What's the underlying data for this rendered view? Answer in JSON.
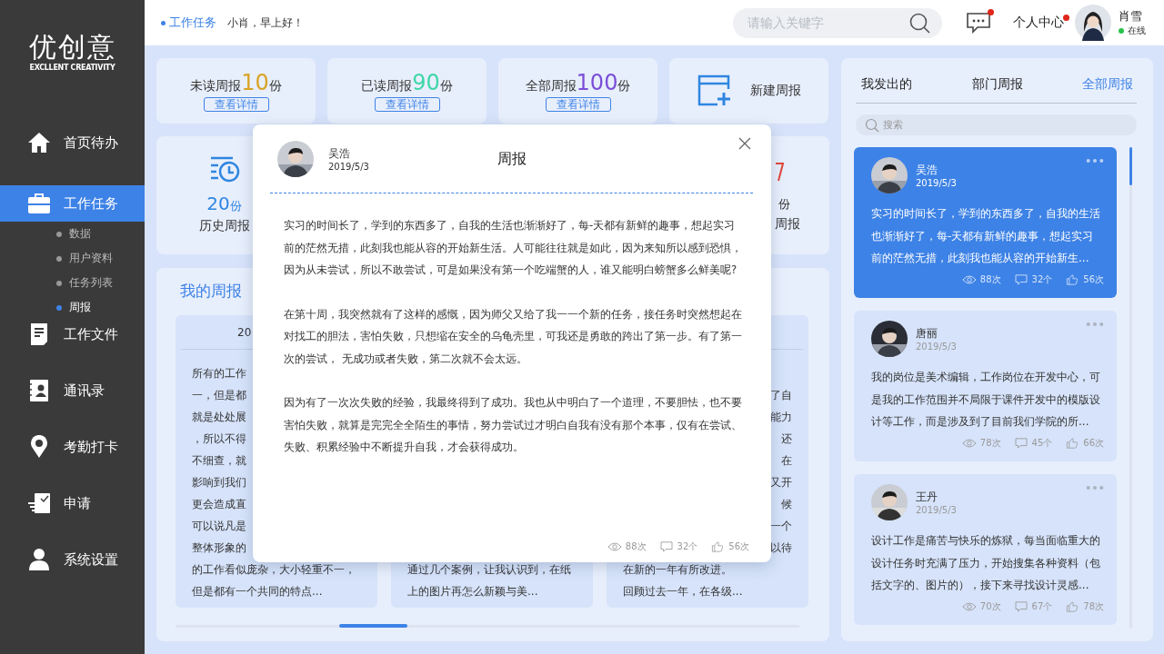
{
  "sidebar": {
    "logo": {
      "title": "优创意",
      "subtitle": "EXCLLENT CREATIVITY"
    },
    "items": [
      {
        "kind": "home",
        "label": "首页待办",
        "selected": false
      },
      {
        "kind": "briefcase",
        "label": "工作任务",
        "selected": true,
        "children": [
          {
            "label": "数据",
            "selected": false
          },
          {
            "label": "用户资料",
            "selected": false
          },
          {
            "label": "任务列表",
            "selected": false
          },
          {
            "label": "周报",
            "selected": true
          }
        ]
      },
      {
        "kind": "document",
        "label": "工作文件",
        "selected": false
      },
      {
        "kind": "contacts",
        "label": "通讯录",
        "selected": false
      },
      {
        "kind": "pin",
        "label": "考勤打卡",
        "selected": false
      },
      {
        "kind": "apply",
        "label": "申请",
        "selected": false
      },
      {
        "kind": "user",
        "label": "系统设置",
        "selected": false
      }
    ]
  },
  "topbar": {
    "breadcrumb": "工作任务",
    "greeting": "小肖，早上好！",
    "search": {
      "placeholder": "请输入关键字"
    },
    "messages": {
      "unread": true
    },
    "profile_link": {
      "label": "个人中心",
      "unread": true
    },
    "user": {
      "name": "肖雪",
      "status": "在线",
      "online": true
    }
  },
  "stats": [
    {
      "kind": "count",
      "label": "未读周报",
      "count": "10",
      "unit": "份",
      "color": "#d9a326",
      "button": "查看详情"
    },
    {
      "kind": "count",
      "label": "已读周报",
      "count": "90",
      "unit": "份",
      "color": "#3fd6a8",
      "button": "查看详情"
    },
    {
      "kind": "count",
      "label": "全部周报",
      "count": "100",
      "unit": "份",
      "color": "#7b4fd8",
      "button": "查看详情"
    },
    {
      "kind": "new",
      "label": "新建周报"
    }
  ],
  "stats_row2": [
    {
      "kind": "history",
      "count": "20",
      "unit": "份",
      "label": "历史周报"
    },
    {
      "kind": "partial",
      "unit": "份",
      "label": "周报"
    }
  ],
  "my_reports": {
    "title": "我的周报",
    "cards": [
      {
        "kind": "clipped_right",
        "date": "20",
        "lines": [
          "所有的工作",
          "一，但是都",
          "就是处处展",
          "，所以不得",
          "不细查，就",
          "影响到我们",
          "更会造成直",
          "可以说凡是",
          "整体形象的",
          "的工作看似庞杂，大小轻重不一，",
          "但是都有一个共同的特点..."
        ]
      },
      {
        "kind": "clipped_top",
        "lines": [
          "通过几个案例，让我认识到，在纸",
          "上的图片再怎么新颖与美..."
        ]
      },
      {
        "kind": "clipped_left",
        "lines": [
          "了自",
          "能力",
          "还",
          "在",
          "又开",
          "候",
          "一个",
          "以待",
          "在新的一年有所改进。",
          "回顾过去一年，在各级..."
        ]
      }
    ]
  },
  "feed": {
    "tabs": [
      {
        "label": "我发出的",
        "selected": false
      },
      {
        "label": "部门周报",
        "selected": false
      },
      {
        "label": "全部周报",
        "selected": true
      }
    ],
    "search": {
      "placeholder": "搜索"
    },
    "posts": [
      {
        "author": "吴浩",
        "date": "2019/5/3",
        "text": "实习的时间长了，学到的东西多了，自我的生活也渐渐好了，每-天都有新鲜的趣事，想起实习前的茫然无措，此刻我也能从容的开始新生...",
        "views": "88次",
        "comments": "32个",
        "likes": "56次",
        "selected": true
      },
      {
        "author": "唐丽",
        "date": "2019/5/3",
        "text": "我的岗位是美术编辑，工作岗位在开发中心，可是我的工作范围并不局限于课件开发中的模版设计等工作，而是涉及到了目前我们学院的所...",
        "views": "78次",
        "comments": "45个",
        "likes": "66次",
        "selected": false
      },
      {
        "author": "王丹",
        "date": "2019/5/3",
        "text": "设计工作是痛苦与快乐的炼狱，每当面临重大的设计任务时充满了压力，开始搜集各种资料（包括文字的、图片的），接下来寻找设计灵感...",
        "views": "70次",
        "comments": "67个",
        "likes": "78次",
        "selected": false
      }
    ]
  },
  "modal": {
    "author": "吴浩",
    "date": "2019/5/3",
    "title": "周报",
    "paragraphs": [
      "实习的时间长了，学到的东西多了，自我的生活也渐渐好了，每-天都有新鲜的趣事，想起实习前的茫然无措，此刻我也能从容的开始新生活。人可能往往就是如此，因为来知所以感到恐惧，因为从未尝试，所以不敢尝试，可是如果没有第一个吃端蟹的人，谁又能明白螃蟹多么鲜美呢?",
      "在第十周，我突然就有了这样的感慨，因为师父又给了我一一个新的任务，接任务时突然想起在对找工的胆法，害怕失败，只想缩在安全的乌龟壳里，可我还是勇敢的跨出了第一步。有了第一次的尝试， 无成功或者失败，第二次就不会太远。",
      "因为有了一次次失败的经验，我最终得到了成功。我也从中明白了一个道理，不要胆怯，也不要害怕失败，就算是完完全全陌生的事情，努力尝试过才明白自我有没有那个本事，仅有在尝试、失败、积累经验中不断提升自我，才会获得成功。"
    ],
    "views": "88次",
    "comments": "32个",
    "likes": "56次"
  }
}
